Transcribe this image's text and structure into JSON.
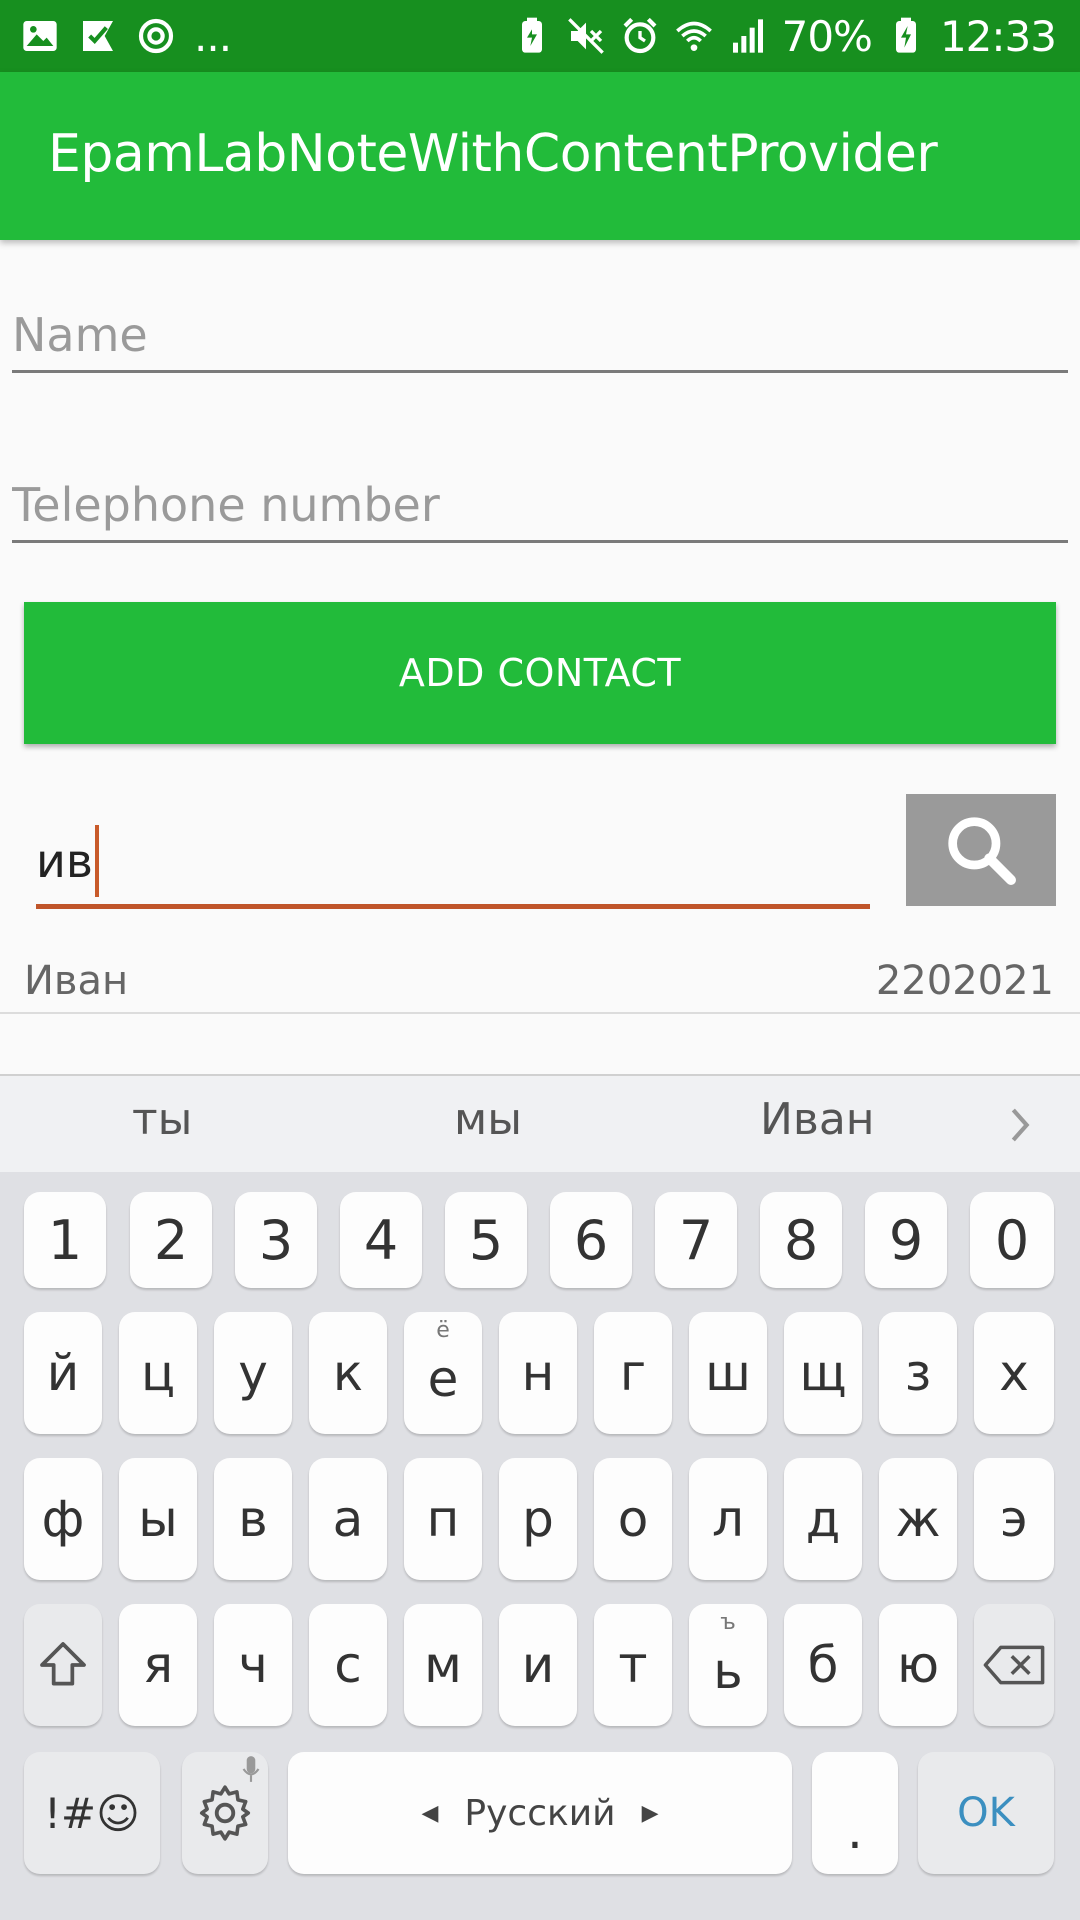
{
  "status_bar": {
    "left_overflow": "...",
    "battery": "70%",
    "time": "12:33"
  },
  "app_bar": {
    "title": "EpamLabNoteWithContentProvider"
  },
  "form": {
    "name_placeholder": "Name",
    "phone_placeholder": "Telephone number",
    "add_button": "ADD CONTACT"
  },
  "search": {
    "value": "ив"
  },
  "results": [
    {
      "name": "Иван",
      "phone": "2202021"
    }
  ],
  "keyboard": {
    "suggestions": [
      "ты",
      "мы",
      "Иван"
    ],
    "row_numbers": [
      "1",
      "2",
      "3",
      "4",
      "5",
      "6",
      "7",
      "8",
      "9",
      "0"
    ],
    "row1": [
      "й",
      "ц",
      "у",
      "к",
      "е",
      "н",
      "г",
      "ш",
      "щ",
      "з",
      "х"
    ],
    "row1_hint_e": "ё",
    "row2": [
      "ф",
      "ы",
      "в",
      "а",
      "п",
      "р",
      "о",
      "л",
      "д",
      "ж",
      "э"
    ],
    "row3": [
      "я",
      "ч",
      "с",
      "м",
      "и",
      "т",
      "ь",
      "б",
      "ю"
    ],
    "row3_hint_soft": "ъ",
    "symbols_label": "!#☺",
    "space_label": "Русский",
    "period_label": ".",
    "ok_label": "OK",
    "ok_color": "#3b8fc0"
  },
  "colors": {
    "primary": "#22bb3a",
    "primary_dark": "#178f1f",
    "accent": "#c0552a"
  }
}
